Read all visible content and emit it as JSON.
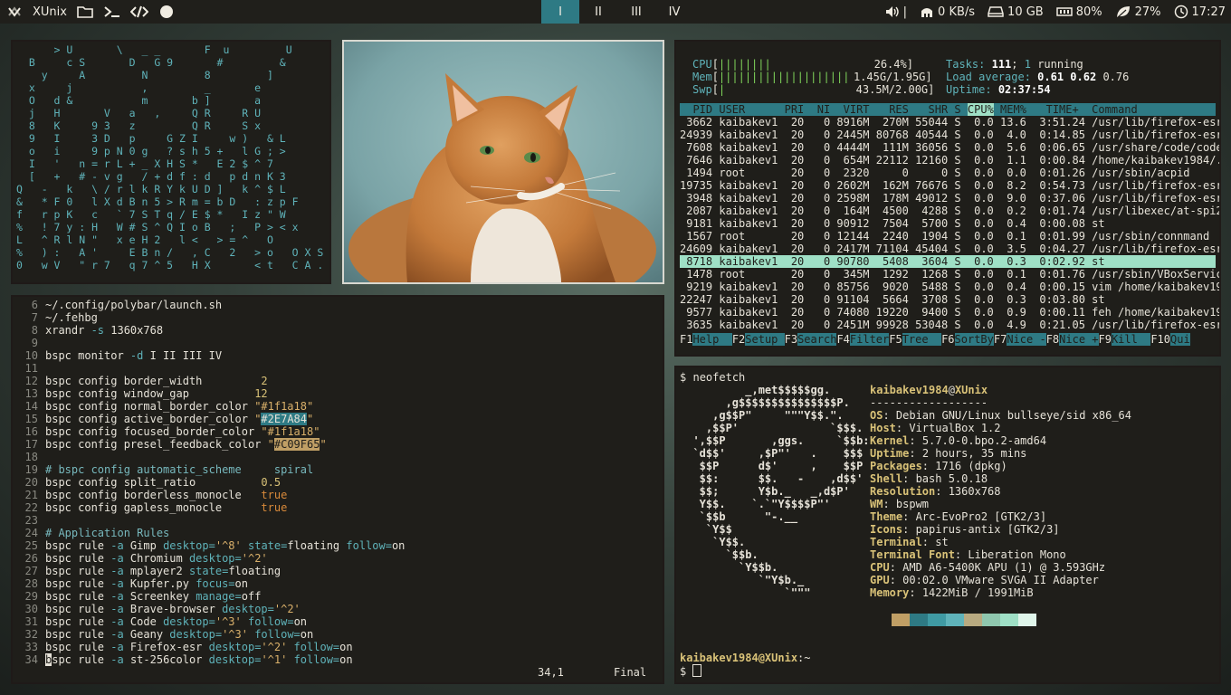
{
  "polybar": {
    "title": "XUnix",
    "left_icons": [
      "folder-icon",
      "terminal-icon",
      "code-icon",
      "theme-icon"
    ],
    "workspaces": [
      {
        "label": "I",
        "active": true
      },
      {
        "label": "II",
        "active": false
      },
      {
        "label": "III",
        "active": false
      },
      {
        "label": "IV",
        "active": false
      }
    ],
    "volume_sep": "|",
    "network": "0 KB/s",
    "disk": "10 GB",
    "memory": "80%",
    "cpu": "27%",
    "clock": "17:27"
  },
  "cmatrix": {
    "lines": [
      "      > U       \\   _ _       F  u         U",
      "  B     c S       D   G 9       #         &",
      "    y     A         N         8         ]",
      "  x     j           ,         _       e",
      "  O   d &           m       b ]       a",
      "  j   H       V   a   ,     Q R     R U",
      "  8   K     9 3   z         Q R     S x",
      "  9   I     3 D   p     G Z I     w )   & L",
      "  o   i     9 p N 0 g   ? s h 5 +   l G ; >",
      "  I   '   n = r L + _ X H S *   E 2 $ ^ 7",
      "  [   +   # - v g   / + d f : d   p d n K 3",
      "Q   -   k   \\ / r l k R Y k U D ]   k ^ $ L",
      "&   * F 0   l X d B n 5 > R m = b D   : z p F",
      "f   r p K   c   ` 7 S T q / E $ *   I z \" W",
      "%   ! 7 y : H   W # S ^ Q I o B   ;   P > < x",
      "L   ^ R l N \"   x e H 2   l <   > = ^   O",
      "%   ) :   A '     E B n /   , C   2   > o   O X S",
      "0   w V   \" r 7   q 7 ^ 5   H X       < t   C A ."
    ]
  },
  "vim": {
    "lines": [
      {
        "n": "6",
        "parts": [
          [
            "",
            "~/.config/polybar/launch.sh"
          ]
        ]
      },
      {
        "n": "7",
        "parts": [
          [
            "",
            "~/.fehbg"
          ]
        ]
      },
      {
        "n": "8",
        "parts": [
          [
            "",
            "xrandr "
          ],
          [
            "opt",
            "-s"
          ],
          [
            "",
            " 1360x768"
          ]
        ]
      },
      {
        "n": "9",
        "parts": [
          [
            "",
            ""
          ]
        ]
      },
      {
        "n": "10",
        "parts": [
          [
            "",
            "bspc monitor "
          ],
          [
            "opt",
            "-d"
          ],
          [
            "",
            " I II III IV"
          ]
        ]
      },
      {
        "n": "11",
        "parts": [
          [
            "",
            ""
          ]
        ]
      },
      {
        "n": "12",
        "parts": [
          [
            "",
            "bspc config border_width         "
          ],
          [
            "kw",
            "2"
          ]
        ]
      },
      {
        "n": "13",
        "parts": [
          [
            "",
            "bspc config window_gap          "
          ],
          [
            "kw",
            "12"
          ]
        ]
      },
      {
        "n": "14",
        "parts": [
          [
            "",
            "bspc config normal_border_color "
          ],
          [
            "str",
            "\"#1f1a18\""
          ]
        ]
      },
      {
        "n": "15",
        "parts": [
          [
            "",
            "bspc config active_border_color "
          ],
          [
            "str",
            "\""
          ],
          [
            "hl-teal",
            "#2E7A84"
          ],
          [
            "str",
            "\""
          ]
        ]
      },
      {
        "n": "16",
        "parts": [
          [
            "",
            "bspc config focused_border_color "
          ],
          [
            "str",
            "\"#1f1a18\""
          ]
        ]
      },
      {
        "n": "17",
        "parts": [
          [
            "",
            "bspc config presel_feedback_color "
          ],
          [
            "str",
            "\""
          ],
          [
            "hl-gold",
            "#C09F65"
          ],
          [
            "str",
            "\""
          ]
        ]
      },
      {
        "n": "18",
        "parts": [
          [
            "",
            ""
          ]
        ]
      },
      {
        "n": "19",
        "parts": [
          [
            "cmt",
            "# bspc config automatic_scheme     spiral"
          ]
        ]
      },
      {
        "n": "20",
        "parts": [
          [
            "",
            "bspc config split_ratio          "
          ],
          [
            "kw",
            "0.5"
          ]
        ]
      },
      {
        "n": "21",
        "parts": [
          [
            "",
            "bspc config borderless_monocle   "
          ],
          [
            "sel",
            "true"
          ]
        ]
      },
      {
        "n": "22",
        "parts": [
          [
            "",
            "bspc config gapless_monocle      "
          ],
          [
            "sel",
            "true"
          ]
        ]
      },
      {
        "n": "23",
        "parts": [
          [
            "",
            ""
          ]
        ]
      },
      {
        "n": "24",
        "parts": [
          [
            "cmt",
            "# Application Rules"
          ]
        ]
      },
      {
        "n": "25",
        "parts": [
          [
            "",
            "bspc rule "
          ],
          [
            "opt",
            "-a"
          ],
          [
            "",
            " Gimp "
          ],
          [
            "opt",
            "desktop="
          ],
          [
            "str",
            "'^8'"
          ],
          [
            "opt",
            " state="
          ],
          [
            "",
            "floating "
          ],
          [
            "opt",
            "follow="
          ],
          [
            "",
            "on"
          ]
        ]
      },
      {
        "n": "26",
        "parts": [
          [
            "",
            "bspc rule "
          ],
          [
            "opt",
            "-a"
          ],
          [
            "",
            " Chromium "
          ],
          [
            "opt",
            "desktop="
          ],
          [
            "str",
            "'^2'"
          ]
        ]
      },
      {
        "n": "27",
        "parts": [
          [
            "",
            "bspc rule "
          ],
          [
            "opt",
            "-a"
          ],
          [
            "",
            " mplayer2 "
          ],
          [
            "opt",
            "state="
          ],
          [
            "",
            "floating"
          ]
        ]
      },
      {
        "n": "28",
        "parts": [
          [
            "",
            "bspc rule "
          ],
          [
            "opt",
            "-a"
          ],
          [
            "",
            " Kupfer.py "
          ],
          [
            "opt",
            "focus="
          ],
          [
            "",
            "on"
          ]
        ]
      },
      {
        "n": "29",
        "parts": [
          [
            "",
            "bspc rule "
          ],
          [
            "opt",
            "-a"
          ],
          [
            "",
            " Screenkey "
          ],
          [
            "opt",
            "manage="
          ],
          [
            "",
            "off"
          ]
        ]
      },
      {
        "n": "30",
        "parts": [
          [
            "",
            "bspc rule "
          ],
          [
            "opt",
            "-a"
          ],
          [
            "",
            " Brave-browser "
          ],
          [
            "opt",
            "desktop="
          ],
          [
            "str",
            "'^2'"
          ]
        ]
      },
      {
        "n": "31",
        "parts": [
          [
            "",
            "bspc rule "
          ],
          [
            "opt",
            "-a"
          ],
          [
            "",
            " Code "
          ],
          [
            "opt",
            "desktop="
          ],
          [
            "str",
            "'^3'"
          ],
          [
            "opt",
            " follow="
          ],
          [
            "",
            "on"
          ]
        ]
      },
      {
        "n": "32",
        "parts": [
          [
            "",
            "bspc rule "
          ],
          [
            "opt",
            "-a"
          ],
          [
            "",
            " Geany "
          ],
          [
            "opt",
            "desktop="
          ],
          [
            "str",
            "'^3'"
          ],
          [
            "opt",
            " follow="
          ],
          [
            "",
            "on"
          ]
        ]
      },
      {
        "n": "33",
        "parts": [
          [
            "",
            "bspc rule "
          ],
          [
            "opt",
            "-a"
          ],
          [
            "",
            " Firefox-esr "
          ],
          [
            "opt",
            "desktop="
          ],
          [
            "str",
            "'^2'"
          ],
          [
            "opt",
            " follow="
          ],
          [
            "",
            "on"
          ]
        ]
      },
      {
        "n": "34",
        "parts": [
          [
            "cursor",
            "b"
          ],
          [
            "",
            "spc rule "
          ],
          [
            "opt",
            "-a"
          ],
          [
            "",
            " st-256color "
          ],
          [
            "opt",
            "desktop="
          ],
          [
            "str",
            "'^1'"
          ],
          [
            "opt",
            " follow="
          ],
          [
            "",
            "on"
          ]
        ]
      }
    ],
    "status_pos": "34,1",
    "status_mode": "Final"
  },
  "htop": {
    "cpu_label": "CPU",
    "cpu_bar": "||||||||",
    "cpu_pct": "26.4%",
    "mem_label": "Mem",
    "mem_bar": "||||||||||||||||||||",
    "mem_val": "1.45G/1.95G",
    "swp_label": "Swp",
    "swp_bar": "|",
    "swp_val": "43.5M/2.00G",
    "tasks_label": "Tasks:",
    "tasks": "111",
    "running": "1",
    "running_label": "running",
    "load_label": "Load average:",
    "load": [
      "0.61",
      "0.62",
      "0.76"
    ],
    "uptime_label": "Uptime:",
    "uptime": "02:37:54",
    "header": {
      "pre": "  PID USER      PRI  NI  VIRT   RES   SHR S ",
      "sort": "CPU%",
      "post": " MEM%   TIME+  Command"
    },
    "rows": [
      {
        "text": " 3662 kaibakev1  20   0 8916M  270M 55044 S  0.0 13.6  3:51.24 /usr/lib/firefox-esr/f",
        "sel": false
      },
      {
        "text": "24939 kaibakev1  20   0 2445M 80768 40544 S  0.0  4.0  0:14.85 /usr/lib/firefox-esr/f",
        "sel": false
      },
      {
        "text": " 7608 kaibakev1  20   0 4444M  111M 36056 S  0.0  5.6  0:06.65 /usr/share/code/code -",
        "sel": false
      },
      {
        "text": " 7646 kaibakev1  20   0  654M 22112 12160 S  0.0  1.1  0:00.84 /home/kaibakev1984/.vs",
        "sel": false
      },
      {
        "text": " 1494 root       20   0  2320     0     0 S  0.0  0.0  0:01.26 /usr/sbin/acpid",
        "sel": false
      },
      {
        "text": "19735 kaibakev1  20   0 2602M  162M 76676 S  0.0  8.2  0:54.73 /usr/lib/firefox-esr/f",
        "sel": false
      },
      {
        "text": " 3948 kaibakev1  20   0 2598M  178M 49012 S  0.0  9.0  0:37.06 /usr/lib/firefox-esr/f",
        "sel": false
      },
      {
        "text": " 2087 kaibakev1  20   0  164M  4500  4288 S  0.0  0.2  0:01.74 /usr/libexec/at-spi2-r",
        "sel": false
      },
      {
        "text": " 9181 kaibakev1  20   0 90912  7504  5700 S  0.0  0.4  0:00.08 st",
        "sel": false
      },
      {
        "text": " 1567 root       20   0 12144  2240  1904 S  0.0  0.1  0:01.99 /usr/sbin/connmand",
        "sel": false
      },
      {
        "text": "24609 kaibakev1  20   0 2417M 71104 45404 S  0.0  3.5  0:04.27 /usr/lib/firefox-esr/f",
        "sel": false
      },
      {
        "text": " 8718 kaibakev1  20   0 90780  5408  3604 S  0.0  0.3  0:02.92 st",
        "sel": true
      },
      {
        "text": " 1478 root       20   0  345M  1292  1268 S  0.0  0.1  0:01.76 /usr/sbin/VBoxService",
        "sel": false
      },
      {
        "text": " 9219 kaibakev1  20   0 85756  9020  5488 S  0.0  0.4  0:00.15 vim /home/kaibakev1984",
        "sel": false
      },
      {
        "text": "22247 kaibakev1  20   0 91104  5664  3708 S  0.0  0.3  0:03.80 st",
        "sel": false
      },
      {
        "text": " 9577 kaibakev1  20   0 74080 19220  9400 S  0.0  0.9  0:00.11 feh /home/kaibakev1984",
        "sel": false
      },
      {
        "text": " 3635 kaibakev1  20   0 2451M 99928 53048 S  0.0  4.9  0:21.05 /usr/lib/firefox-esr/f",
        "sel": false
      }
    ],
    "fkeys": [
      {
        "k": "F1",
        "l": "Help  "
      },
      {
        "k": "F2",
        "l": "Setup "
      },
      {
        "k": "F3",
        "l": "Search"
      },
      {
        "k": "F4",
        "l": "Filter"
      },
      {
        "k": "F5",
        "l": "Tree  "
      },
      {
        "k": "F6",
        "l": "SortBy"
      },
      {
        "k": "F7",
        "l": "Nice -"
      },
      {
        "k": "F8",
        "l": "Nice +"
      },
      {
        "k": "F9",
        "l": "Kill  "
      },
      {
        "k": "F10",
        "l": "Qui"
      }
    ]
  },
  "neofetch": {
    "command": "neofetch",
    "prompt_symbol": "$",
    "logo": [
      "          _,met$$$$$gg.",
      "       ,g$$$$$$$$$$$$$$$P.",
      "     ,g$$P\"     \"\"\"Y$$.\".",
      "    ,$$P'              `$$$.",
      "  ',$$P       ,ggs.     `$$b:",
      "  `d$$'     ,$P\"'   .    $$$",
      "   $$P      d$'     ,    $$P",
      "   $$:      $$.   -    ,d$$'",
      "   $$;      Y$b._   _,d$P'",
      "   Y$$.    `.`\"Y$$$$P\"'",
      "   `$$b      \"-.__",
      "    `Y$$",
      "     `Y$$.",
      "       `$$b.",
      "         `Y$$b.",
      "            `\"Y$b._",
      "                `\"\"\""
    ],
    "user": "kaibakev1984",
    "host": "XUnix",
    "separator": "------------------",
    "info": [
      {
        "k": "OS",
        "v": "Debian GNU/Linux bullseye/sid x86_64"
      },
      {
        "k": "Host",
        "v": "VirtualBox 1.2"
      },
      {
        "k": "Kernel",
        "v": "5.7.0-0.bpo.2-amd64"
      },
      {
        "k": "Uptime",
        "v": "2 hours, 35 mins"
      },
      {
        "k": "Packages",
        "v": "1716 (dpkg)"
      },
      {
        "k": "Shell",
        "v": "bash 5.0.18"
      },
      {
        "k": "Resolution",
        "v": "1360x768"
      },
      {
        "k": "WM",
        "v": "bspwm"
      },
      {
        "k": "Theme",
        "v": "Arc-EvoPro2 [GTK2/3]"
      },
      {
        "k": "Icons",
        "v": "papirus-antix [GTK2/3]"
      },
      {
        "k": "Terminal",
        "v": "st"
      },
      {
        "k": "Terminal Font",
        "v": "Liberation Mono"
      },
      {
        "k": "CPU",
        "v": "AMD A6-5400K APU (1) @ 3.593GHz"
      },
      {
        "k": "GPU",
        "v": "00:02.0 VMware SVGA II Adapter"
      },
      {
        "k": "Memory",
        "v": "1422MiB / 1991MiB"
      }
    ],
    "palette": [
      "#c09f65",
      "#2e7a84",
      "#3f9aa3",
      "#5fb3ba",
      "#b8aa80",
      "#8fc7ae",
      "#9fe0c6",
      "#dff5ea"
    ],
    "prompt_user": "kaibakev1984@XUnix",
    "prompt_path": ":~"
  },
  "colors": {
    "accent": "#2E7A84",
    "gold": "#C09F65",
    "selection": "#9fe0c6"
  }
}
